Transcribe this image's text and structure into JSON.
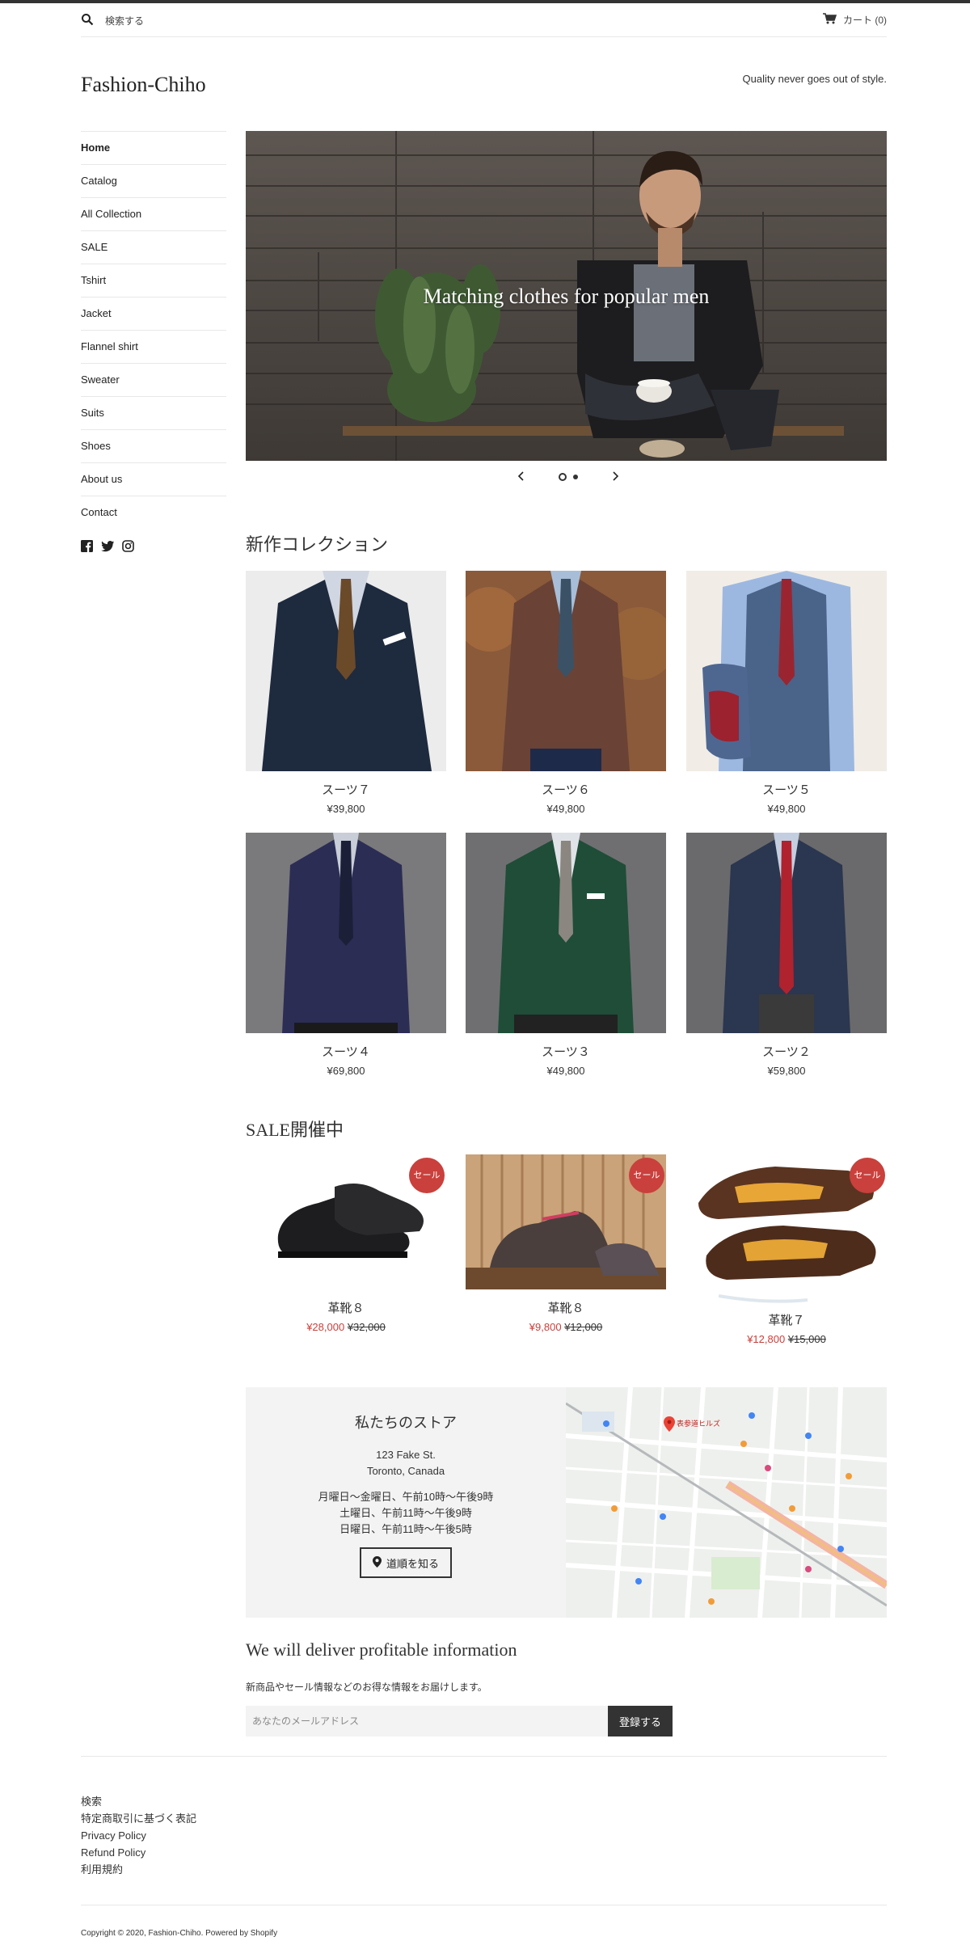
{
  "header": {
    "search_placeholder": "検索する",
    "cart_label": "カート (0)"
  },
  "site": {
    "logo": "Fashion-Chiho",
    "tagline": "Quality never goes out of style."
  },
  "sidebar": {
    "items": [
      {
        "label": "Home",
        "active": true
      },
      {
        "label": "Catalog"
      },
      {
        "label": "All Collection"
      },
      {
        "label": "SALE"
      },
      {
        "label": "Tshirt"
      },
      {
        "label": "Jacket"
      },
      {
        "label": "Flannel shirt"
      },
      {
        "label": "Sweater"
      },
      {
        "label": "Suits"
      },
      {
        "label": "Shoes"
      },
      {
        "label": "About us"
      },
      {
        "label": "Contact"
      }
    ],
    "social_icons": [
      "facebook-icon",
      "twitter-icon",
      "instagram-icon"
    ]
  },
  "hero": {
    "title": "Matching clothes for popular men",
    "slides_total": 2,
    "current_slide": 1
  },
  "new_collection": {
    "title": "新作コレクション",
    "products": [
      {
        "name": "スーツ７",
        "price": "¥39,800",
        "color": "#1e2a3e"
      },
      {
        "name": "スーツ６",
        "price": "¥49,800",
        "color": "#6a4236"
      },
      {
        "name": "スーツ５",
        "price": "¥49,800",
        "color": "#4a6388"
      },
      {
        "name": "スーツ４",
        "price": "¥69,800",
        "color": "#2c2d55"
      },
      {
        "name": "スーツ３",
        "price": "¥49,800",
        "color": "#1f4d38"
      },
      {
        "name": "スーツ２",
        "price": "¥59,800",
        "color": "#2b3650"
      }
    ]
  },
  "sale": {
    "title": "SALE開催中",
    "badge": "セール",
    "products": [
      {
        "name": "革靴８",
        "sale_price": "¥28,000",
        "original_price": "¥32,000"
      },
      {
        "name": "革靴８",
        "sale_price": "¥9,800",
        "original_price": "¥12,000"
      },
      {
        "name": "革靴７",
        "sale_price": "¥12,800",
        "original_price": "¥15,000"
      }
    ]
  },
  "store": {
    "title": "私たちのストア",
    "address_line1": "123 Fake St.",
    "address_line2": "Toronto, Canada",
    "hours_line1": "月曜日〜金曜日、午前10時〜午後9時",
    "hours_line2": "土曜日、午前11時〜午後9時",
    "hours_line3": "日曜日、午前11時〜午後5時",
    "directions_label": "道順を知る",
    "map_pin_label": "表参道ヒルズ"
  },
  "newsletter": {
    "title": "We will deliver profitable information",
    "description": "新商品やセール情報などのお得な情報をお届けします。",
    "email_placeholder": "あなたのメールアドレス",
    "submit_label": "登録する"
  },
  "footer": {
    "links": [
      "検索",
      "特定商取引に基づく表記",
      "Privacy Policy",
      "Refund Policy",
      "利用規約"
    ],
    "copyright_prefix": "Copyright © 2020, ",
    "copyright_brand": "Fashion-Chiho",
    "copyright_suffix": ". ",
    "powered_by": "Powered by Shopify"
  },
  "colors": {
    "sale_red": "#c9403c",
    "dark": "#333333",
    "panel_bg": "#f3f3f3"
  }
}
